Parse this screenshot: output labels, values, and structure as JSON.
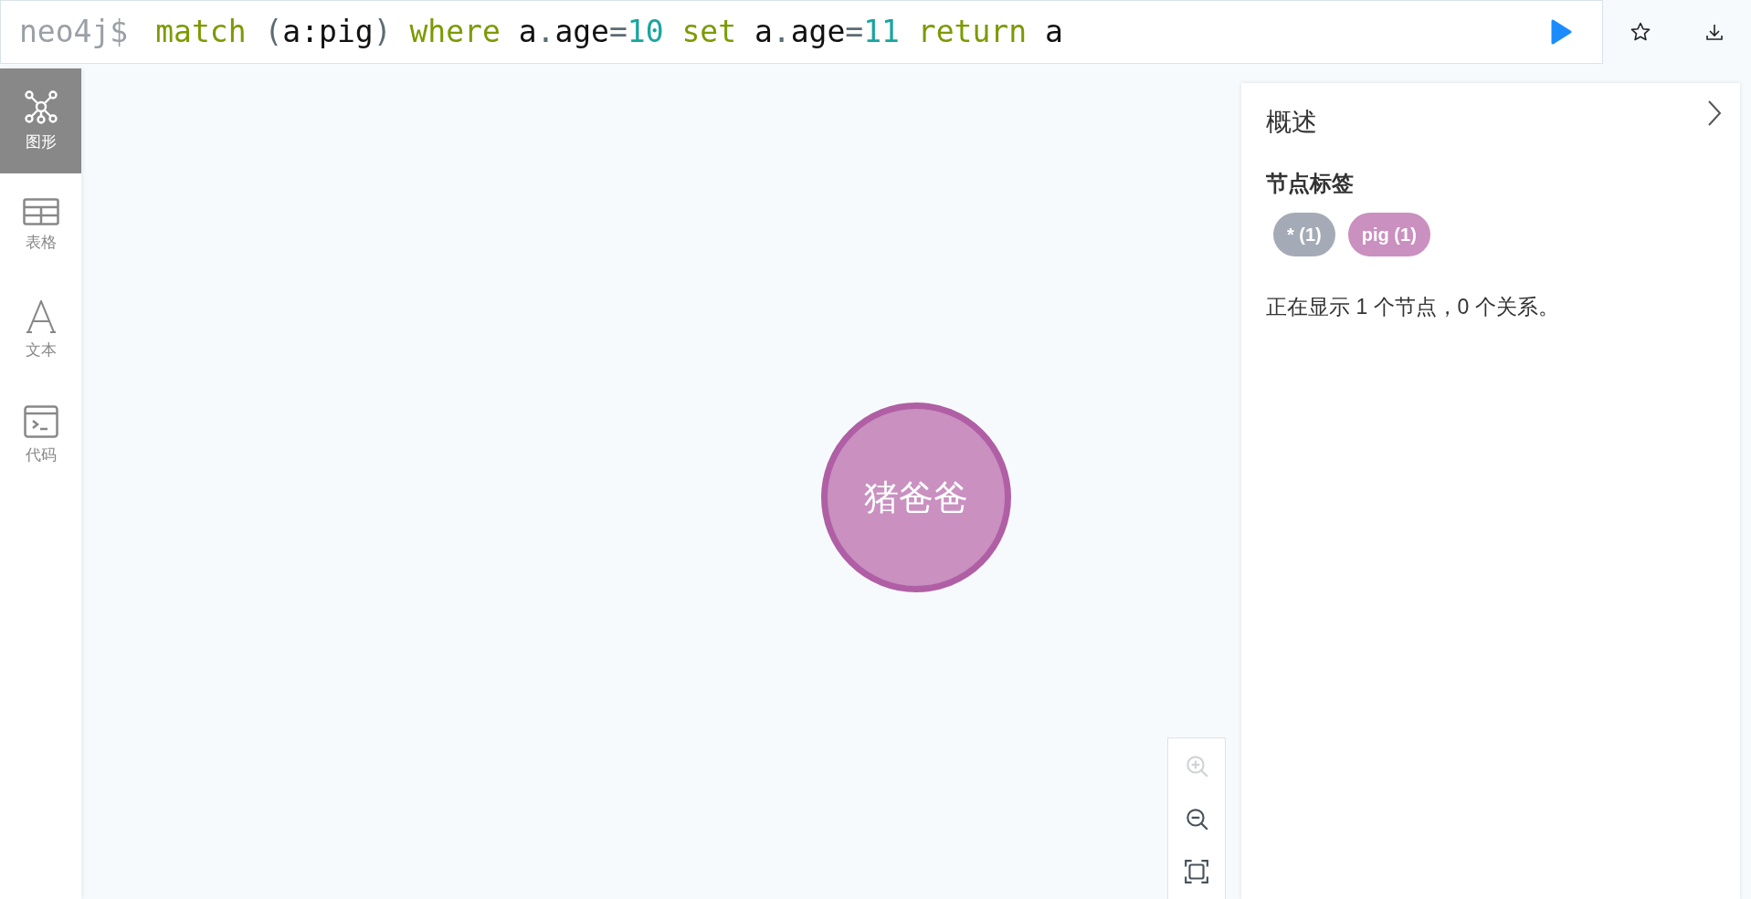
{
  "editor": {
    "prompt": "neo4j$",
    "tokens": [
      {
        "text": "match ",
        "kind": "keyword"
      },
      {
        "text": "(",
        "kind": "punct"
      },
      {
        "text": "a:pig",
        "kind": "ident"
      },
      {
        "text": ") ",
        "kind": "punct"
      },
      {
        "text": "where ",
        "kind": "keyword"
      },
      {
        "text": "a",
        "kind": "ident"
      },
      {
        "text": ".",
        "kind": "punct"
      },
      {
        "text": "age",
        "kind": "ident"
      },
      {
        "text": "=",
        "kind": "punct"
      },
      {
        "text": "10 ",
        "kind": "number"
      },
      {
        "text": "set ",
        "kind": "keyword"
      },
      {
        "text": "a",
        "kind": "ident"
      },
      {
        "text": ".",
        "kind": "punct"
      },
      {
        "text": "age",
        "kind": "ident"
      },
      {
        "text": "=",
        "kind": "punct"
      },
      {
        "text": "11 ",
        "kind": "number"
      },
      {
        "text": "return ",
        "kind": "keyword"
      },
      {
        "text": "a",
        "kind": "ident"
      }
    ]
  },
  "sidebar": {
    "items": [
      {
        "label": "图形",
        "kind": "graph",
        "selected": true
      },
      {
        "label": "表格",
        "kind": "table",
        "selected": false
      },
      {
        "label": "文本",
        "kind": "text",
        "selected": false
      },
      {
        "label": "代码",
        "kind": "code",
        "selected": false
      }
    ]
  },
  "graph": {
    "nodes": [
      {
        "caption": "猪爸爸",
        "color": "#c990c0"
      }
    ]
  },
  "zoom_controls": [
    {
      "kind": "zoom-in",
      "disabled": true
    },
    {
      "kind": "zoom-out",
      "disabled": false
    },
    {
      "kind": "fit",
      "disabled": false
    }
  ],
  "overview": {
    "title": "概述",
    "section": "节点标签",
    "labels": [
      {
        "text": "* (1)",
        "color": "#a5abb6"
      },
      {
        "text": "pig (1)",
        "color": "#c990c0"
      }
    ],
    "summary": "正在显示 1 个节点，0 个关系。"
  }
}
